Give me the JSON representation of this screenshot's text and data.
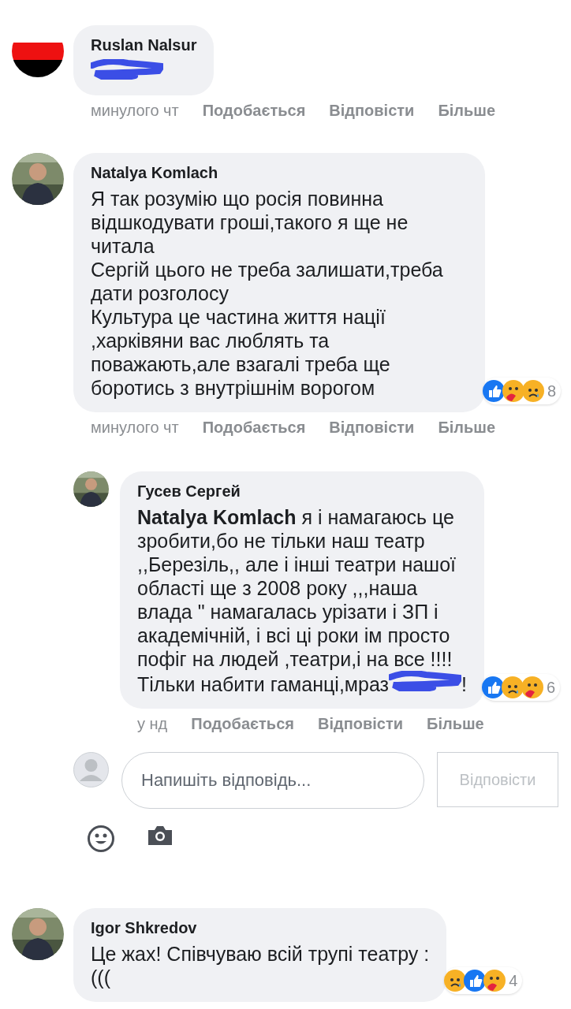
{
  "comments": [
    {
      "author": "Ruslan Nalsur",
      "avatar": {
        "kind": "flag"
      },
      "redacted": true,
      "time": "минулого чт",
      "actions": [
        "Подобається",
        "Відповісти",
        "Більше"
      ]
    },
    {
      "author": "Natalya Komlach",
      "text": "Я так розумію що росія повинна відшкодувати гроші,такого я ще не читала\nСергій цього не треба залишати,треба дати розголосу\nКультура це частина життя нації\n,харківяни вас люблять та поважають,але взагалі треба ще боротись з внутрішнім ворогом",
      "reactions": [
        {
          "kind": "like"
        },
        {
          "kind": "care"
        },
        {
          "kind": "sad"
        }
      ],
      "reaction_count": "8",
      "time": "минулого чт",
      "actions": [
        "Подобається",
        "Відповісти",
        "Більше"
      ],
      "replies": [
        {
          "author": "Гусев Сергей",
          "text": "**Natalya Komlach** я і намагаюсь це зробити,бо не тільки наш театр ,,Березіль,, але і інші театри нашої області ще з 2008 року ,,,наша влада \" намагалась урізати і ЗП і академічній, і всі ці роки ім просто пофіг на людей ,театри,і на все !!!!Тільки набити гаманці,мраз",
          "redacted": true,
          "text_after": "!",
          "reactions": [
            {
              "kind": "like"
            },
            {
              "kind": "sad"
            },
            {
              "kind": "care"
            }
          ],
          "reaction_count": "6",
          "time": "у нд",
          "actions": [
            "Подобається",
            "Відповісти",
            "Більше"
          ]
        }
      ],
      "reply_box": {
        "placeholder": "Напишіть відповідь...",
        "button": "Відповісти"
      }
    },
    {
      "author": "Igor Shkredov",
      "text": "Це жах! Співчуваю всій трупі театру :\n(((",
      "reactions": [
        {
          "kind": "sad"
        },
        {
          "kind": "like"
        },
        {
          "kind": "care"
        }
      ],
      "reaction_count": "4"
    }
  ]
}
